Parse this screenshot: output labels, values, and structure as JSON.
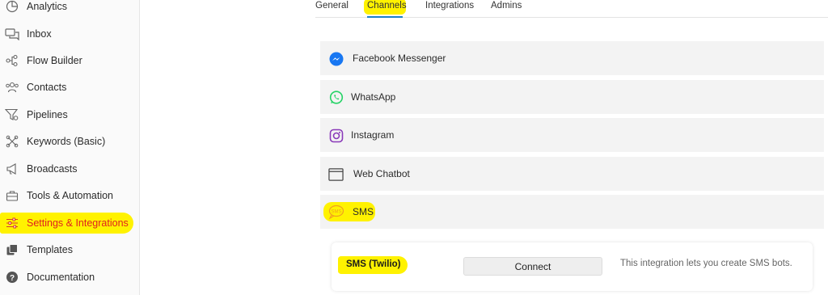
{
  "sidebar": {
    "items": [
      {
        "label": "Analytics",
        "icon": "analytics-icon"
      },
      {
        "label": "Inbox",
        "icon": "inbox-icon"
      },
      {
        "label": "Flow Builder",
        "icon": "flow-builder-icon"
      },
      {
        "label": "Contacts",
        "icon": "contacts-icon"
      },
      {
        "label": "Pipelines",
        "icon": "pipelines-icon"
      },
      {
        "label": "Keywords (Basic)",
        "icon": "keywords-icon"
      },
      {
        "label": "Broadcasts",
        "icon": "broadcasts-icon"
      },
      {
        "label": "Tools & Automation",
        "icon": "tools-icon"
      },
      {
        "label": "Settings & Integrations",
        "icon": "settings-sliders-icon"
      },
      {
        "label": "Templates",
        "icon": "templates-icon"
      },
      {
        "label": "Documentation",
        "icon": "help-icon"
      }
    ],
    "active_index": 8
  },
  "tabs": [
    {
      "label": "General"
    },
    {
      "label": "Channels"
    },
    {
      "label": "Integrations"
    },
    {
      "label": "Admins"
    }
  ],
  "active_tab": "Channels",
  "channels": [
    {
      "label": "Facebook Messenger",
      "icon": "messenger-icon"
    },
    {
      "label": "WhatsApp",
      "icon": "whatsapp-icon"
    },
    {
      "label": "Instagram",
      "icon": "instagram-icon"
    },
    {
      "label": "Web Chatbot",
      "icon": "browser-window-icon"
    },
    {
      "label": "SMS",
      "icon": "sms-icon",
      "icon_text": "SMS"
    }
  ],
  "sms_integration": {
    "title": "SMS (Twilio)",
    "button_label": "Connect",
    "description": "This integration lets you create SMS bots."
  },
  "colors": {
    "highlight": "#fff200",
    "active_text": "#e02020",
    "tab_underline": "#1a7fc9",
    "messenger": "#1877f2",
    "whatsapp": "#25d366",
    "instagram": "#8a3ab9"
  }
}
